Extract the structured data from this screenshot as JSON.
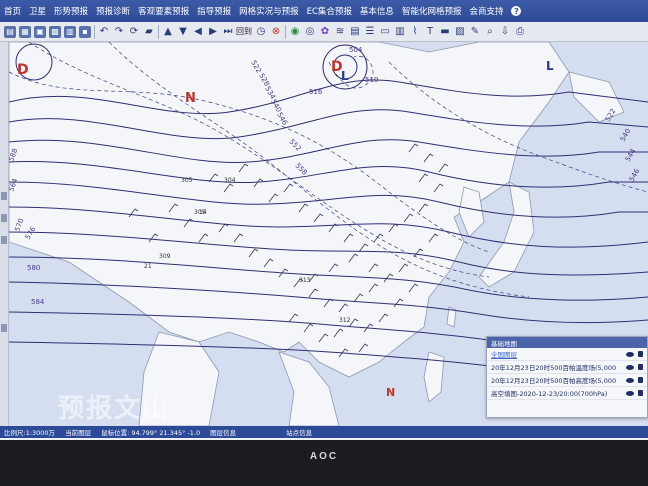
{
  "menu": {
    "items": [
      "首页",
      "卫星",
      "形势预报",
      "预报诊断",
      "客观要素预报",
      "指导预报",
      "网格实况与预报",
      "EC集合预报",
      "基本信息",
      "智能化网格预报",
      "会商支持"
    ]
  },
  "toolbar": {
    "reset_label": "回到"
  },
  "map": {
    "pressure_labels": [
      "D",
      "D",
      "L",
      "N",
      "N",
      "L"
    ],
    "contour_labels": [
      "522",
      "528",
      "534",
      "540",
      "546",
      "552",
      "558",
      "564",
      "570",
      "576",
      "580",
      "584",
      "588",
      "522",
      "540",
      "544",
      "546",
      "510",
      "504",
      "516"
    ],
    "station_values": [
      "305",
      "304",
      "305",
      "14",
      "21",
      "309",
      "313",
      "312"
    ]
  },
  "layer_panel": {
    "title": "基础地图",
    "rows": [
      "全国图层",
      "20年12月23日20时500百帕温度场(5,000",
      "20年12月23日20时500百帕高度场(5,000",
      "高空填图-2020-12-23/20:00(700hPa)"
    ]
  },
  "statusbar": {
    "items": [
      "比例尺:1:3000万",
      "当前图层",
      "鼠标位置: 94.799° 21.345° -1.0",
      "图层信息",
      "站点信息"
    ]
  },
  "watermark": "预报文山",
  "monitor_logo": "AOC"
}
